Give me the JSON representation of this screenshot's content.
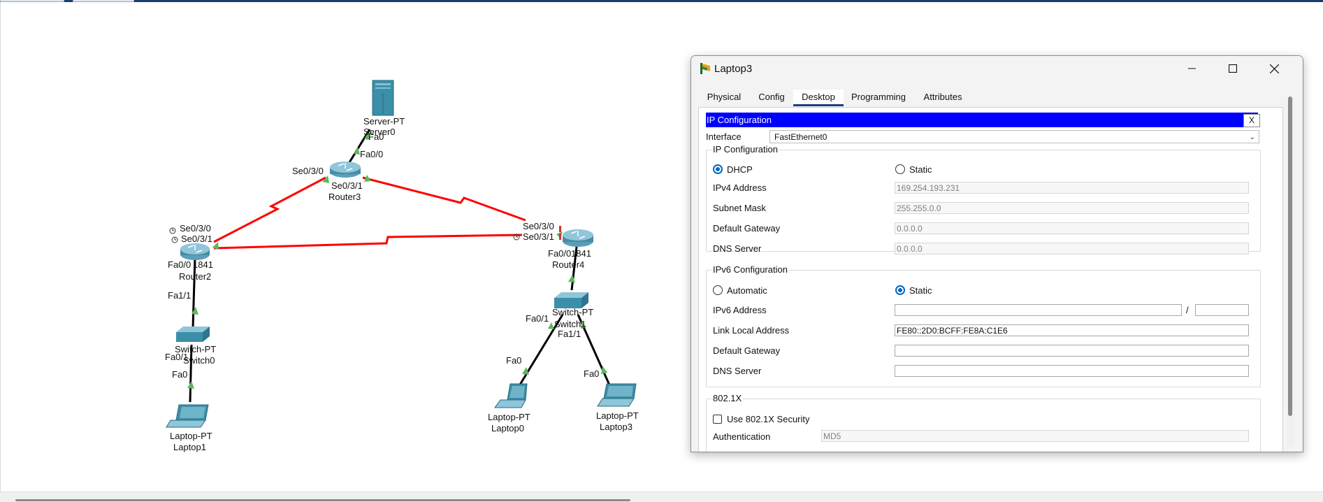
{
  "topology": {
    "devices": {
      "server": {
        "type": "Server-PT",
        "name": "Server0"
      },
      "router3": {
        "name": "Router3"
      },
      "router2": {
        "model": "1841",
        "name": "Router2"
      },
      "router4": {
        "model": "1841",
        "name": "Router4"
      },
      "switch0": {
        "type": "Switch-PT",
        "name": "Switch0"
      },
      "switch1": {
        "type": "Switch-PT",
        "name": "Switch1"
      },
      "laptop1": {
        "type": "Laptop-PT",
        "name": "Laptop1"
      },
      "laptop0": {
        "type": "Laptop-PT",
        "name": "Laptop0"
      },
      "laptop3": {
        "type": "Laptop-PT",
        "name": "Laptop3"
      }
    },
    "ports": {
      "server_fa0": "Fa0",
      "r3_fa00": "Fa0/0",
      "r3_se030": "Se0/3/0",
      "r3_se031": "Se0/3/1",
      "r2_se030": "Se0/3/0",
      "r2_se031": "Se0/3/1",
      "r2_fa00": "Fa0/0",
      "r4_se030": "Se0/3/0",
      "r4_se031": "Se0/3/1",
      "r4_fa00": "Fa0/0",
      "sw0_fa11": "Fa1/1",
      "sw0_fa01": "Fa0/1",
      "laptop1_fa0": "Fa0",
      "sw1_fa01": "Fa0/1",
      "sw1_fa11": "Fa1/1",
      "laptop0_fa0": "Fa0",
      "laptop3_fa0": "Fa0"
    },
    "colors": {
      "serial_link": "#ff0000",
      "ethernet_link": "#000000",
      "link_up": "#5cb85c",
      "device": "#3b8fa8"
    }
  },
  "dialog": {
    "title": "Laptop3",
    "tabs": [
      "Physical",
      "Config",
      "Desktop",
      "Programming",
      "Attributes"
    ],
    "active_tab": "Desktop",
    "ip_config": {
      "header": "IP Configuration",
      "close": "X",
      "interface_label": "Interface",
      "interface_value": "FastEthernet0",
      "ipv4": {
        "title": "IP Configuration",
        "mode_dhcp": "DHCP",
        "mode_static": "Static",
        "selected": "DHCP",
        "ipv4_label": "IPv4 Address",
        "ipv4_value": "169.254.193.231",
        "mask_label": "Subnet Mask",
        "mask_value": "255.255.0.0",
        "gateway_label": "Default Gateway",
        "gateway_value": "0.0.0.0",
        "dns_label": "DNS Server",
        "dns_value": "0.0.0.0"
      },
      "ipv6": {
        "title": "IPv6 Configuration",
        "mode_auto": "Automatic",
        "mode_static": "Static",
        "selected": "Static",
        "ipv6_label": "IPv6 Address",
        "ipv6_value": "",
        "prefix_sep": "/",
        "prefix_value": "",
        "link_local_label": "Link Local Address",
        "link_local_value": "FE80::2D0:BCFF:FE8A:C1E6",
        "gateway_label": "Default Gateway",
        "gateway_value": "",
        "dns_label": "DNS Server",
        "dns_value": ""
      },
      "dot1x": {
        "title": "802.1X",
        "use_label": "Use 802.1X Security",
        "auth_label": "Authentication",
        "auth_value": "MD5"
      }
    }
  }
}
